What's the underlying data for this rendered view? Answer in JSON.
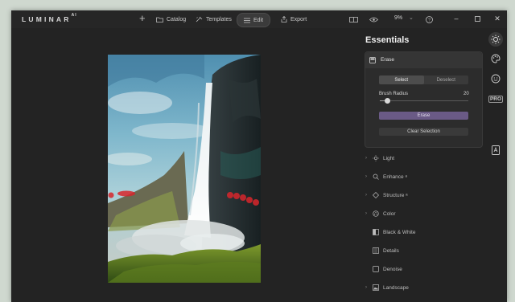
{
  "app": {
    "logo": "LUMINAR",
    "logo_suffix": "AI"
  },
  "nav": {
    "catalog": "Catalog",
    "templates": "Templates",
    "edit": "Edit",
    "export": "Export",
    "active": "edit"
  },
  "toolbar": {
    "zoom": "9%"
  },
  "panel": {
    "title": "Essentials",
    "erase": {
      "title": "Erase",
      "select_label": "Select",
      "deselect_label": "Deselect",
      "mode": "select",
      "brush_radius_label": "Brush Radius",
      "brush_radius_value": "20",
      "brush_radius_fraction": 0.08,
      "erase_button": "Erase",
      "clear_button": "Clear Selection"
    },
    "tools": [
      {
        "label": "Light",
        "icon": "sun-icon",
        "has_chevron": true
      },
      {
        "label": "Enhance ᵃ",
        "icon": "enhance-icon",
        "has_chevron": true
      },
      {
        "label": "Structure ᵃ",
        "icon": "structure-icon",
        "has_chevron": true
      },
      {
        "label": "Color",
        "icon": "color-icon",
        "has_chevron": true
      },
      {
        "label": "Black & White",
        "icon": "bw-icon",
        "has_chevron": false
      },
      {
        "label": "Details",
        "icon": "details-icon",
        "has_chevron": false
      },
      {
        "label": "Denoise",
        "icon": "denoise-icon",
        "has_chevron": false
      },
      {
        "label": "Landscape",
        "icon": "landscape-icon",
        "has_chevron": true
      }
    ]
  },
  "side_icons": [
    "essentials-sun-icon",
    "creative-palette-icon",
    "portrait-face-icon",
    "pro-icon",
    "layers-icon"
  ],
  "colors": {
    "accent": "#6a5a86",
    "background": "#232323",
    "mask": "#d7262c"
  }
}
